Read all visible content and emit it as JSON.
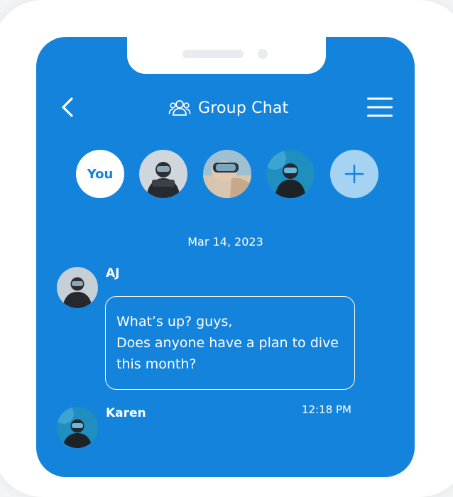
{
  "header": {
    "title": "Group Chat",
    "back_icon": "chevron-left-icon",
    "title_icon": "users-icon",
    "menu_icon": "hamburger-menu-icon"
  },
  "participants": [
    {
      "label": "You"
    },
    {
      "label": ""
    },
    {
      "label": ""
    },
    {
      "label": ""
    }
  ],
  "add_participant_icon": "plus-icon",
  "chat": {
    "date": "Mar 14, 2023",
    "messages": [
      {
        "sender": "AJ",
        "lines": [
          "What’s up? guys,",
          "Does anyone have a plan to dive",
          "this month?"
        ]
      },
      {
        "sender": "Karen",
        "time": "12:18 PM"
      }
    ]
  },
  "colors": {
    "screen_bg": "#1483dc",
    "add_button_bg": "#a7d3f3",
    "text": "#ffffff"
  }
}
